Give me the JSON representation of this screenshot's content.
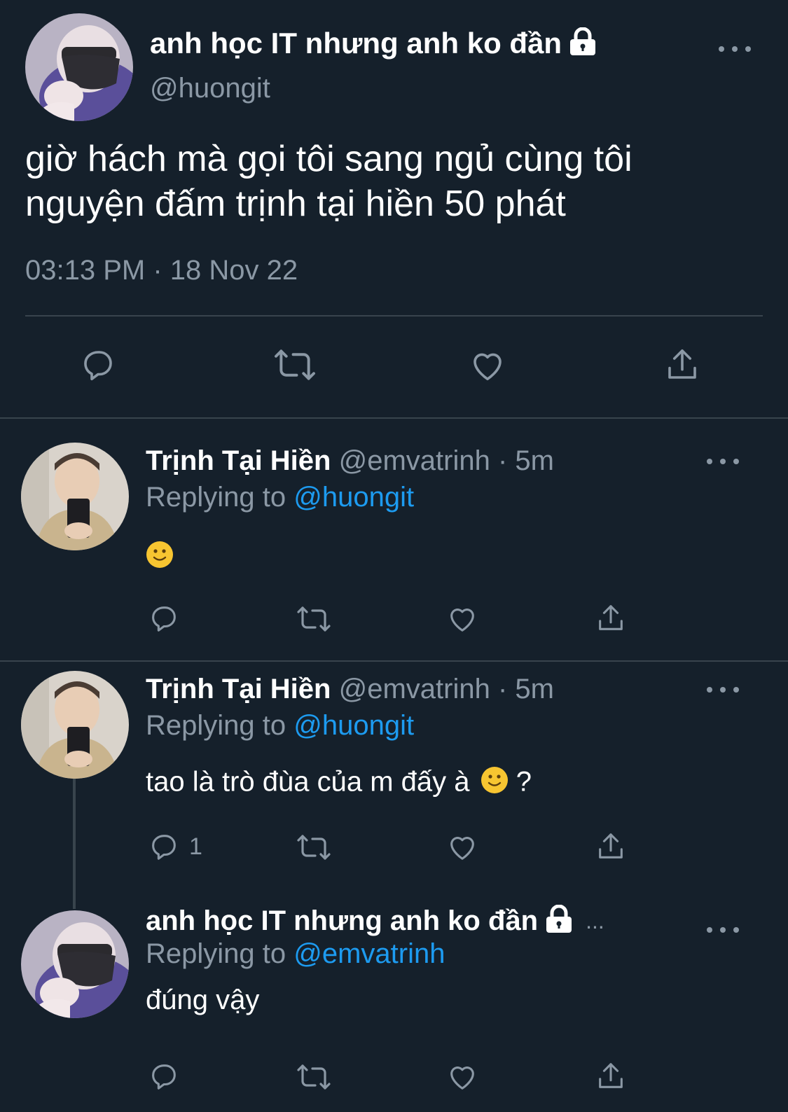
{
  "main_tweet": {
    "display_name": "anh học IT nhưng anh ko đần",
    "handle": "@huongit",
    "text_line1": "giờ hách mà gọi tôi sang ngủ cùng tôi",
    "text_line2": "nguyện đấm trịnh tại hiền 50 phát",
    "timestamp": "03:13 PM · 18 Nov 22"
  },
  "replies": [
    {
      "display_name": "Trịnh Tại Hiền",
      "handle": "@emvatrinh",
      "time": "· 5m",
      "replying_prefix": "Replying to",
      "replying_to": "@huongit",
      "text": "",
      "reply_count": ""
    },
    {
      "display_name": "Trịnh Tại Hiền",
      "handle": "@emvatrinh",
      "time": "· 5m",
      "replying_prefix": "Replying to",
      "replying_to": "@huongit",
      "text": "tao là trò đùa của m đấy à",
      "text_suffix": "?",
      "reply_count": "1"
    },
    {
      "display_name": "anh học IT nhưng anh ko đần",
      "truncation": "...",
      "replying_prefix": "Replying to",
      "replying_to": "@emvatrinh",
      "text": "đúng vậy",
      "reply_count": ""
    }
  ],
  "icons": {
    "lock": "lock-icon",
    "more": "more-icon",
    "reply": "reply-icon",
    "retweet": "retweet-icon",
    "like": "like-icon",
    "share": "share-icon",
    "emoji": "slightly-smiling-face-emoji"
  },
  "colors": {
    "background": "#15202b",
    "text": "#ffffff",
    "muted": "#8b98a5",
    "link": "#1d9bf0",
    "divider": "#38444d"
  }
}
